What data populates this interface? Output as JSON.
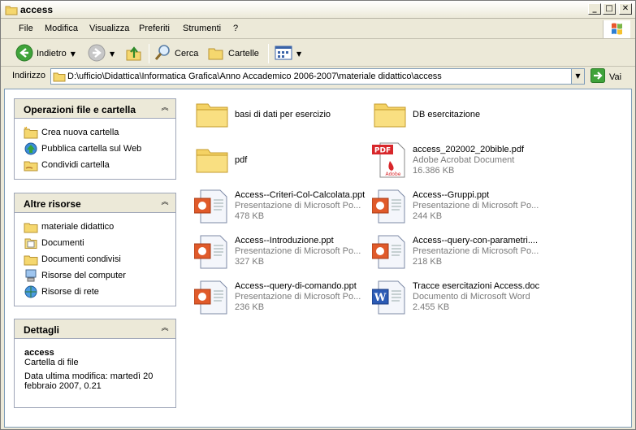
{
  "window": {
    "title": "access"
  },
  "menu": [
    {
      "label": "File"
    },
    {
      "label": "Modifica"
    },
    {
      "label": "Visualizza"
    },
    {
      "label": "Preferiti"
    },
    {
      "label": "Strumenti"
    },
    {
      "label": "?"
    }
  ],
  "toolbar": {
    "back_label": "Indietro",
    "search_label": "Cerca",
    "folders_label": "Cartelle"
  },
  "address": {
    "label": "Indirizzo",
    "path": "D:\\ufficio\\Didattica\\Informatica Grafica\\Anno Accademico 2006-2007\\materiale didattico\\access",
    "go_label": "Vai"
  },
  "taskpane": {
    "ops": {
      "title": "Operazioni file e cartella",
      "links": [
        {
          "label": "Crea nuova cartella",
          "icon": "new-folder-icon"
        },
        {
          "label": "Pubblica cartella sul Web",
          "icon": "publish-web-icon"
        },
        {
          "label": "Condividi cartella",
          "icon": "share-folder-icon"
        }
      ]
    },
    "other": {
      "title": "Altre risorse",
      "links": [
        {
          "label": "materiale didattico",
          "icon": "folder-icon"
        },
        {
          "label": "Documenti",
          "icon": "documents-icon"
        },
        {
          "label": "Documenti condivisi",
          "icon": "shared-documents-icon"
        },
        {
          "label": "Risorse del computer",
          "icon": "computer-icon"
        },
        {
          "label": "Risorse di rete",
          "icon": "network-icon"
        }
      ]
    },
    "details": {
      "title": "Dettagli",
      "name": "access",
      "kind": "Cartella di file",
      "modified_1": "Data ultima modifica: martedì 20",
      "modified_2": "febbraio 2007, 0.21"
    }
  },
  "files": [
    {
      "name": "basi di dati per esercizio",
      "type": "",
      "size": "",
      "icon": "folder-icon"
    },
    {
      "name": "DB esercitazione",
      "type": "",
      "size": "",
      "icon": "folder-icon"
    },
    {
      "name": "pdf",
      "type": "",
      "size": "",
      "icon": "folder-icon"
    },
    {
      "name": "access_202002_20bible.pdf",
      "type": "Adobe Acrobat Document",
      "size": "16.386 KB",
      "icon": "pdf-icon"
    },
    {
      "name": "Access--Criteri-Col-Calcolata.ppt",
      "type": "Presentazione di Microsoft Po...",
      "size": "478 KB",
      "icon": "ppt-icon"
    },
    {
      "name": "Access--Gruppi.ppt",
      "type": "Presentazione di Microsoft Po...",
      "size": "244 KB",
      "icon": "ppt-icon"
    },
    {
      "name": "Access--Introduzione.ppt",
      "type": "Presentazione di Microsoft Po...",
      "size": "327 KB",
      "icon": "ppt-icon"
    },
    {
      "name": "Access--query-con-parametri....",
      "type": "Presentazione di Microsoft Po...",
      "size": "218 KB",
      "icon": "ppt-icon"
    },
    {
      "name": "Access--query-di-comando.ppt",
      "type": "Presentazione di Microsoft Po...",
      "size": "236 KB",
      "icon": "ppt-icon"
    },
    {
      "name": "Tracce esercitazioni Access.doc",
      "type": "Documento di Microsoft Word",
      "size": "2.455 KB",
      "icon": "doc-icon"
    }
  ]
}
